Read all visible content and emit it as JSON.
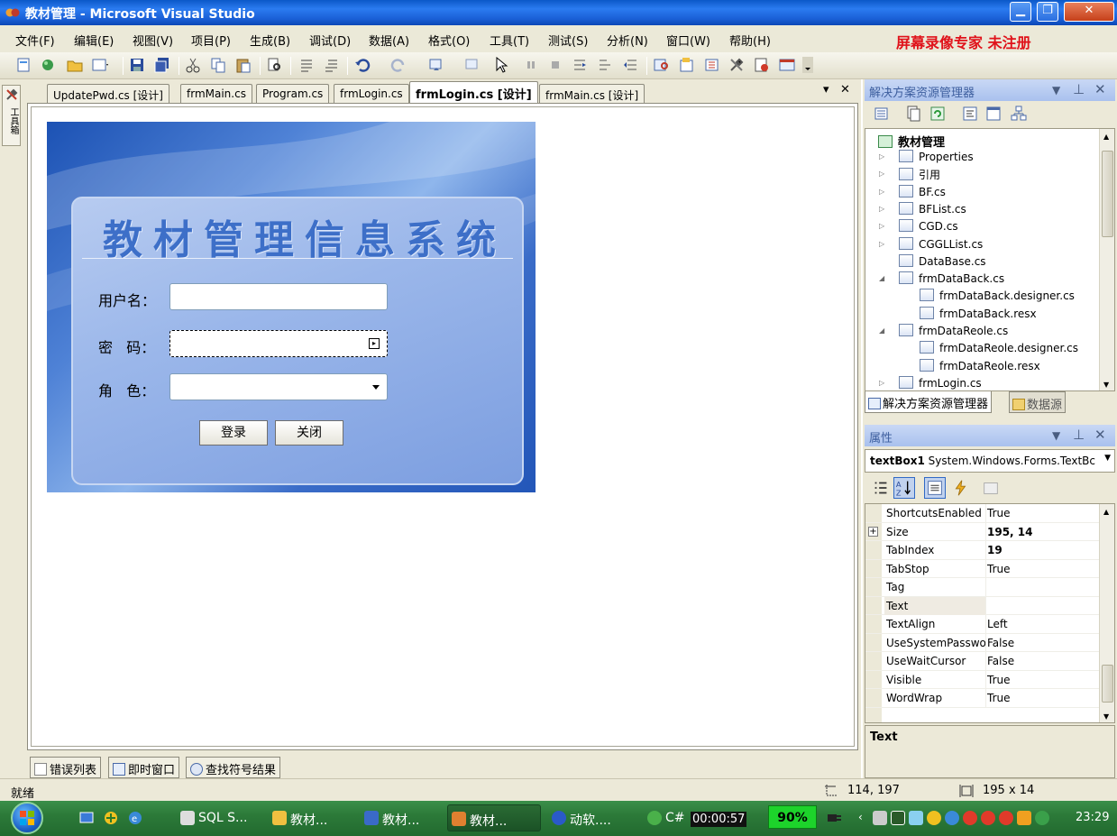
{
  "window": {
    "title": "教材管理 - Microsoft Visual Studio"
  },
  "menu": {
    "items": [
      "文件(F)",
      "编辑(E)",
      "视图(V)",
      "项目(P)",
      "生成(B)",
      "调试(D)",
      "数据(A)",
      "格式(O)",
      "工具(T)",
      "测试(S)",
      "分析(N)",
      "窗口(W)",
      "帮助(H)"
    ],
    "watermark": "屏幕录像专家  未注册"
  },
  "toolbox": {
    "label": "工具箱"
  },
  "doc_tabs": [
    "UpdatePwd.cs [设计]",
    "frmMain.cs",
    "Program.cs",
    "frmLogin.cs",
    "frmLogin.cs [设计]",
    "frmMain.cs [设计]"
  ],
  "doc_tab_controls": {
    "dropdown": "▾",
    "close": "✕"
  },
  "login_form": {
    "title": "教材管理信息系统",
    "username_label": "用户名：",
    "password_label": "密   码：",
    "role_label": "角   色：",
    "login_button": "登录",
    "close_button": "关闭"
  },
  "bottom_tabs": [
    "错误列表",
    "即时窗口",
    "查找符号结果"
  ],
  "solution_explorer": {
    "title": "解决方案资源管理器",
    "root": "教材管理",
    "items": [
      {
        "label": "Properties",
        "level": 1,
        "twisty": "▷"
      },
      {
        "label": "引用",
        "level": 1,
        "twisty": "▷"
      },
      {
        "label": "BF.cs",
        "level": 1,
        "twisty": "▷"
      },
      {
        "label": "BFList.cs",
        "level": 1,
        "twisty": "▷"
      },
      {
        "label": "CGD.cs",
        "level": 1,
        "twisty": "▷"
      },
      {
        "label": "CGGLList.cs",
        "level": 1,
        "twisty": "▷"
      },
      {
        "label": "DataBase.cs",
        "level": 1,
        "twisty": ""
      },
      {
        "label": "frmDataBack.cs",
        "level": 1,
        "twisty": "◢"
      },
      {
        "label": "frmDataBack.designer.cs",
        "level": 2,
        "twisty": ""
      },
      {
        "label": "frmDataBack.resx",
        "level": 2,
        "twisty": ""
      },
      {
        "label": "frmDataReole.cs",
        "level": 1,
        "twisty": "◢"
      },
      {
        "label": "frmDataReole.designer.cs",
        "level": 2,
        "twisty": ""
      },
      {
        "label": "frmDataReole.resx",
        "level": 2,
        "twisty": ""
      },
      {
        "label": "frmLogin.cs",
        "level": 1,
        "twisty": "▷"
      }
    ],
    "tabs": [
      "解决方案资源管理器",
      "数据源"
    ]
  },
  "properties": {
    "title": "属性",
    "object_name": "textBox1",
    "object_type": "System.Windows.Forms.TextBc",
    "rows": [
      {
        "name": "ShortcutsEnabled",
        "value": "True"
      },
      {
        "name": "Size",
        "value": "195, 14"
      },
      {
        "name": "TabIndex",
        "value": "19"
      },
      {
        "name": "TabStop",
        "value": "True"
      },
      {
        "name": "Tag",
        "value": ""
      },
      {
        "name": "Text",
        "value": ""
      },
      {
        "name": "TextAlign",
        "value": "Left"
      },
      {
        "name": "UseSystemPasswo",
        "value": "False"
      },
      {
        "name": "UseWaitCursor",
        "value": "False"
      },
      {
        "name": "Visible",
        "value": "True"
      },
      {
        "name": "WordWrap",
        "value": "True"
      }
    ],
    "description_title": "Text"
  },
  "status": {
    "text": "就绪",
    "position": "114, 197",
    "size": "195 x 14"
  },
  "taskbar": {
    "items": [
      "SQL S...",
      "教材...",
      "教材...",
      "教材...",
      "动软....",
      "C#"
    ],
    "timer": "00:00:57",
    "percent": "90%",
    "clock": "23:29"
  }
}
